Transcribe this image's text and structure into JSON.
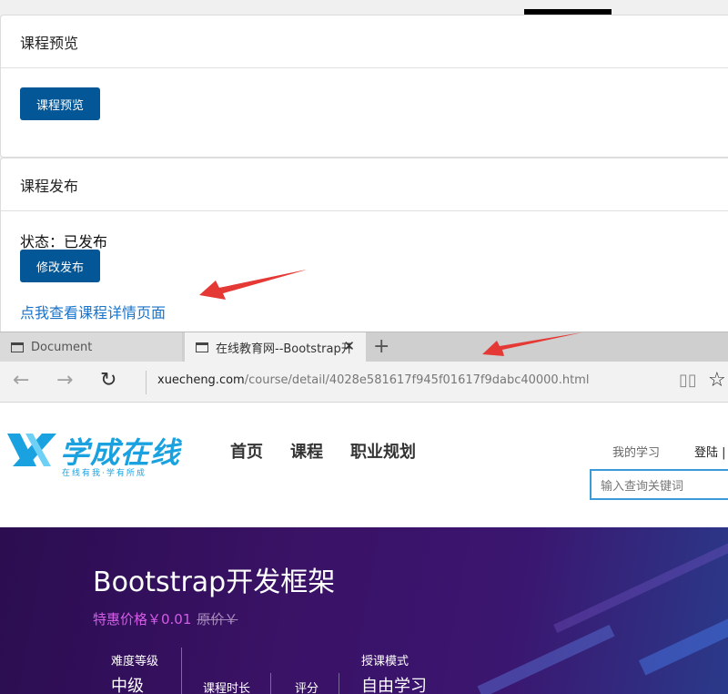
{
  "preview_panel": {
    "title": "课程预览",
    "button_label": "课程预览"
  },
  "publish_panel": {
    "title": "课程发布",
    "status_text": "状态：已发布",
    "button_label": "修改发布",
    "detail_link": "点我查看课程详情页面"
  },
  "browser": {
    "tabs": [
      {
        "label": "Document",
        "active": false
      },
      {
        "label": "在线教育网--Bootstrap开",
        "active": true
      }
    ],
    "new_tab_icon": "+",
    "address_host": "xuecheng.com",
    "address_path": "/course/detail/4028e581617f945f01617f9dabc40000.html"
  },
  "site": {
    "logo_text": "学成在线",
    "logo_sub": "在线有我·学有所成",
    "menu": [
      "首页",
      "课程",
      "职业规划"
    ],
    "my_learning": "我的学习",
    "login": "登陆 |",
    "search_placeholder": "输入查询关键词"
  },
  "hero": {
    "title": "Bootstrap开发框架",
    "price_special": "特惠价格￥0.01",
    "price_original": "原价￥",
    "meta": {
      "difficulty_label": "难度等级",
      "difficulty_value": "中级",
      "duration_label": "课程时长",
      "rating_label": "评分",
      "mode_label": "授课模式",
      "mode_value": "自由学习"
    }
  },
  "colors": {
    "primary_button": "#045797",
    "link": "#1a73c9",
    "arrow": "#e53935",
    "hero_bg": "#3a1266",
    "price_special": "#d35ce6"
  }
}
